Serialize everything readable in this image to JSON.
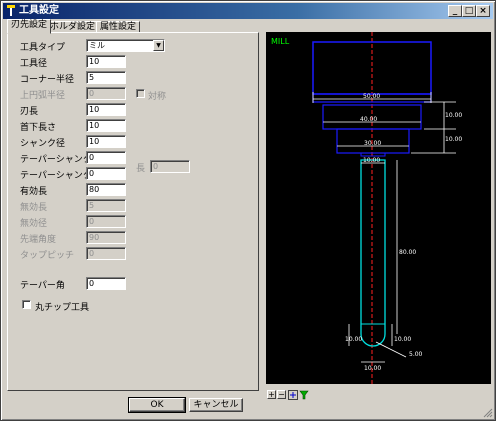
{
  "window": {
    "title": "工具設定"
  },
  "tabs": [
    "刃先設定",
    "ホルダ設定",
    "属性設定"
  ],
  "form": {
    "tool_type": {
      "label": "工具タイプ",
      "value": "ミル"
    },
    "rows": [
      {
        "label": "工具径",
        "value": "10",
        "enabled": true
      },
      {
        "label": "コーナー半径",
        "value": "5",
        "enabled": true
      },
      {
        "label": "上円弧半径",
        "value": "0",
        "enabled": false
      },
      {
        "label": "刃長",
        "value": "10",
        "enabled": true
      },
      {
        "label": "首下長さ",
        "value": "10",
        "enabled": true
      },
      {
        "label": "シャンク径",
        "value": "10",
        "enabled": true
      },
      {
        "label": "テーパーシャンク角",
        "value": "0",
        "enabled": true
      },
      {
        "label": "テーパーシャンク角2",
        "value": "0",
        "enabled": true
      },
      {
        "label": "有効長",
        "value": "80",
        "enabled": true
      },
      {
        "label": "無効長",
        "value": "5",
        "enabled": false
      },
      {
        "label": "無効径",
        "value": "0",
        "enabled": false
      },
      {
        "label": "先端角度",
        "value": "90",
        "enabled": false
      },
      {
        "label": "タップピッチ",
        "value": "0",
        "enabled": false
      },
      {
        "label": "テーパー角",
        "value": "0",
        "enabled": true
      }
    ],
    "symmetric_checkbox": {
      "label": "対称"
    },
    "length_field": {
      "label": "長",
      "value": "0"
    },
    "round_tip_checkbox": {
      "label": "丸チップ工具"
    }
  },
  "buttons": {
    "ok": "OK",
    "cancel": "キャンセル"
  },
  "preview": {
    "tool_type_label": "MILL",
    "dims": [
      "50.00",
      "40.00",
      "30.00",
      "10.00",
      "10.00",
      "10.00",
      "80.00",
      "10.00",
      "10.00",
      "5.00",
      "10.00"
    ]
  },
  "zoom_buttons": {
    "plus": "+",
    "minus": "−"
  },
  "colors": {
    "preview_bg": "#000000",
    "holder": "#1a1aff",
    "cutter": "#00e0e0",
    "dimension": "#ffffff",
    "axis": "#ff2020",
    "label": "#00ff00"
  }
}
